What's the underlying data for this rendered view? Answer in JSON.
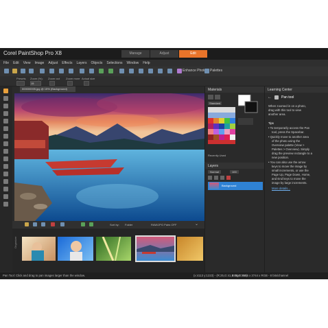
{
  "app": {
    "title": "Corel PaintShop Pro X8",
    "workspace_tabs": [
      "Manage",
      "Adjust",
      "Edit"
    ],
    "active_tab": "Edit"
  },
  "menu": [
    "File",
    "Edit",
    "View",
    "Image",
    "Adjust",
    "Effects",
    "Layers",
    "Objects",
    "Selections",
    "Window",
    "Help"
  ],
  "toolbar": {
    "enhance_label": "Enhance Photo",
    "palettes_label": "Palettes"
  },
  "tool_options": {
    "presets": "Presets",
    "zoom_label": "Zoom (%):",
    "zoom_value": "15",
    "zoom_out": "Zoom out",
    "zoom_more": "Zoom more",
    "actual_size": "Actual size"
  },
  "document": {
    "tab_title": "000000005.jpg @ 15% (Background)"
  },
  "organizer": {
    "label": "Organizer",
    "sort_label": "Sort by:",
    "sort_value": "Folder",
    "raw_label": "RAW/JPG Pairs OFF"
  },
  "materials": {
    "title": "Materials",
    "swatch_set": "Standard",
    "recently_used": "Recently Used"
  },
  "layers": {
    "title": "Layers",
    "blend_mode": "Normal",
    "opacity": "100",
    "layer_name": "Background"
  },
  "learning_center": {
    "title": "Learning Center",
    "tool_name": "Pan tool",
    "intro": [
      "When zoomed in on a photo,",
      "drag with this tool to view",
      "another area."
    ],
    "tips_heading": "Tips",
    "tips": [
      [
        "To temporarily access the Pan",
        "tool, press the Spacebar."
      ],
      [
        "Quickly move to another area",
        "of the photo using the",
        "Overview palette (View >",
        "Palettes > Overview). Simply",
        "drag the preview rectangle to a",
        "new position."
      ],
      [
        "You can also use the arrow",
        "keys to move the image by",
        "small increments, or use the",
        "Page Up, Page Down, Home,",
        "and End keys to move the",
        "image by large increments."
      ]
    ],
    "more_link": "More details..."
  },
  "status": {
    "left": "Pan Tool: Click and drag to pan images larger than the window.",
    "mid": "(x:4113 y:1223) - (R:25,G:41,B:75,O:255)",
    "right": "Image: 5616 x 3744 x RGB - 8 bits/channel"
  },
  "colors": {
    "accent": "#e8742a",
    "panel_bg": "#2a2a2a",
    "selection_blue": "#2f82d4"
  }
}
